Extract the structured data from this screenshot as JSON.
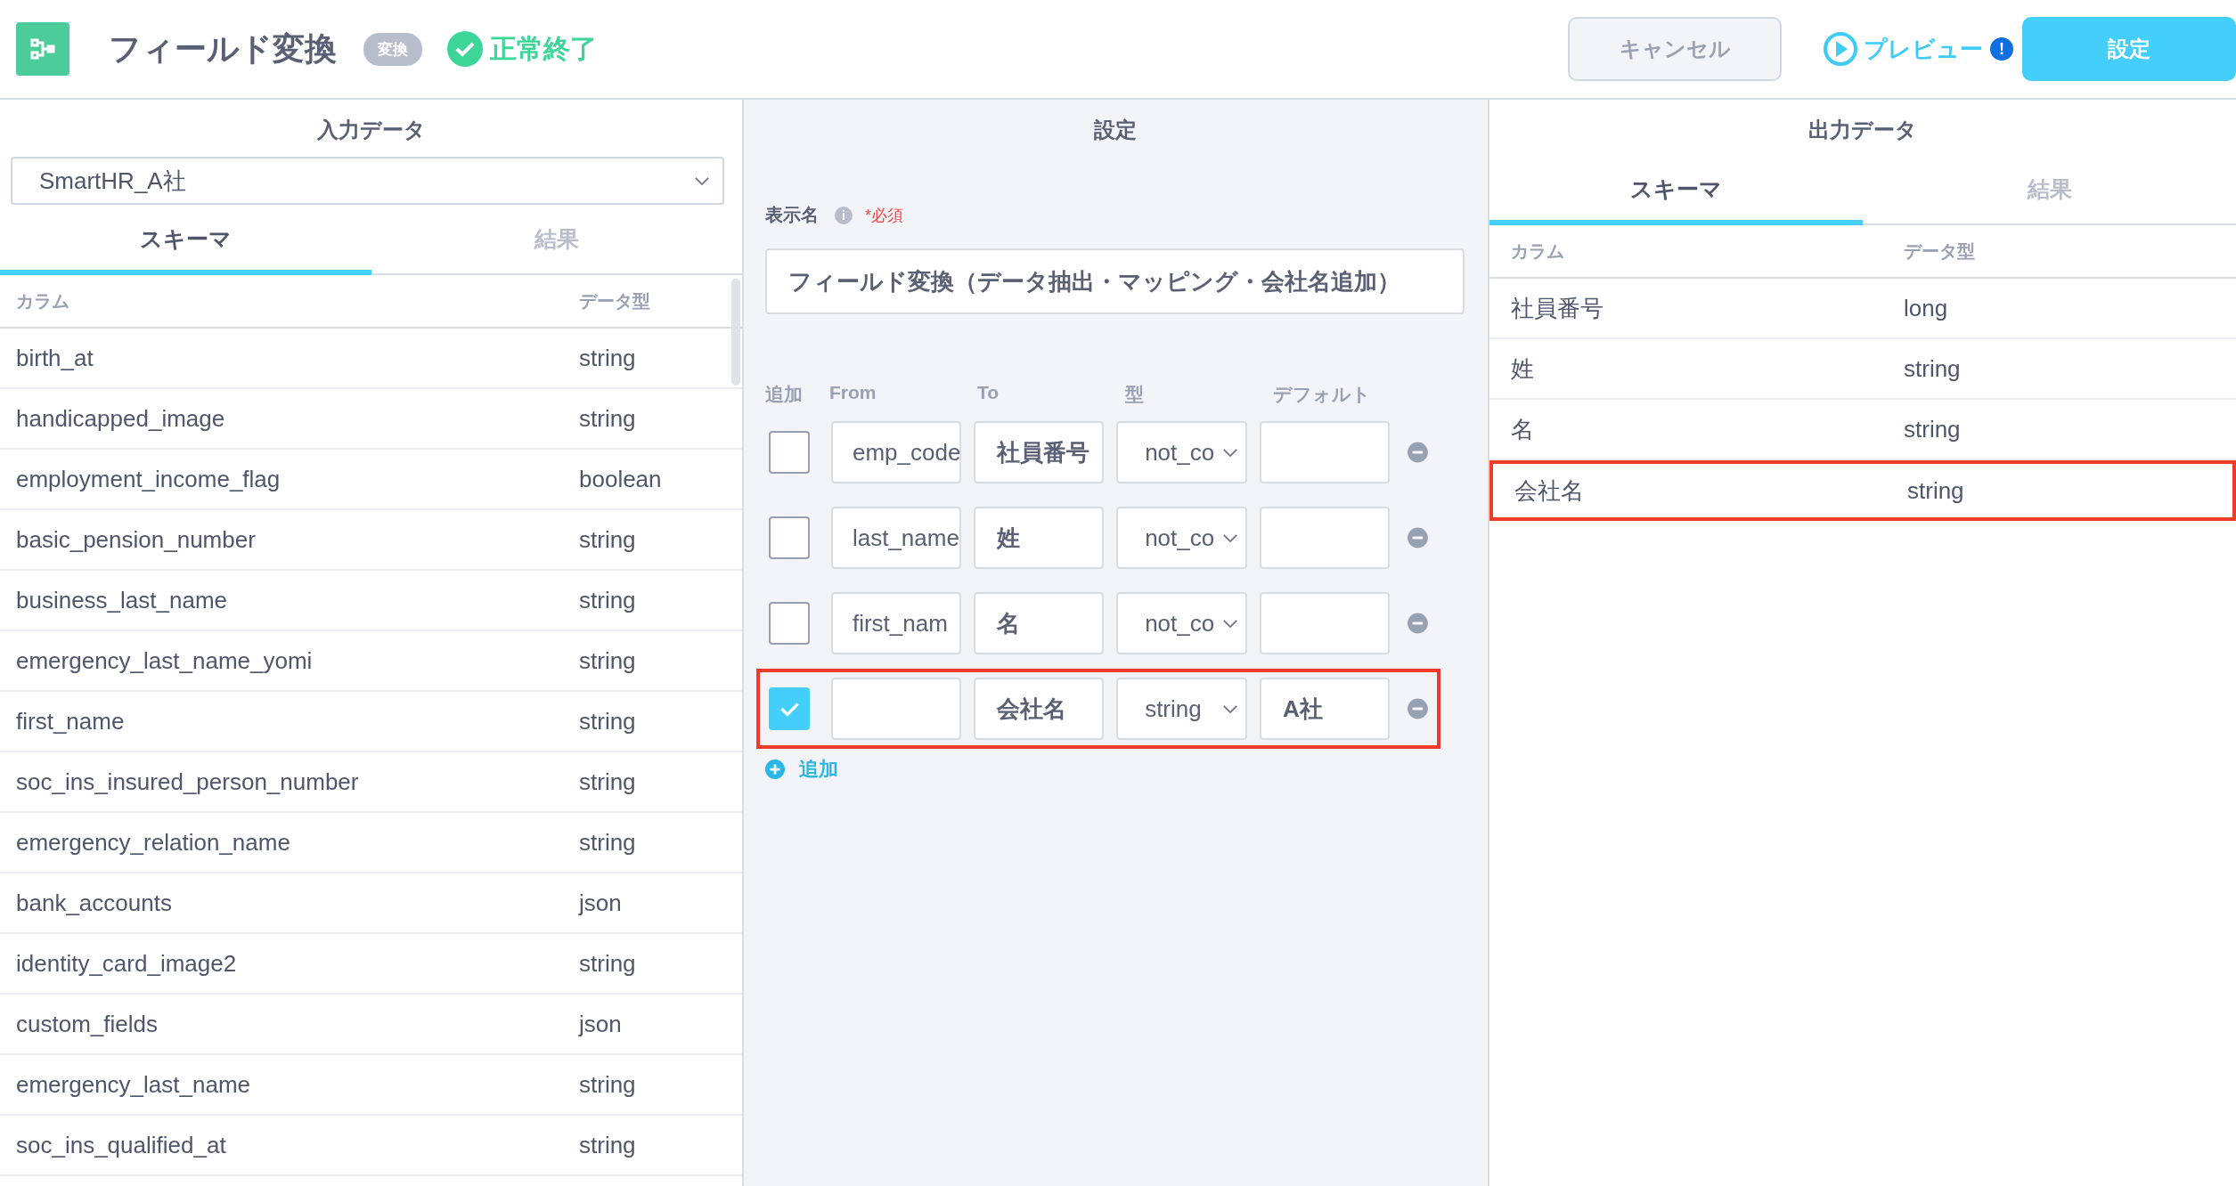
{
  "header": {
    "title": "フィールド変換",
    "badge": "変換",
    "status": "正常終了",
    "buttons": [
      {
        "label": "キャンセル",
        "kind": "secondary"
      },
      {
        "label": "プレビュー",
        "kind": "preview",
        "warning": "!"
      },
      {
        "label": "設定",
        "kind": "primary"
      }
    ]
  },
  "input_panel": {
    "title": "入力データ",
    "source": "SmartHR_A社",
    "tabs": [
      {
        "label": "スキーマ",
        "selected": true
      },
      {
        "label": "結果",
        "selected": false
      }
    ],
    "columns": [
      "カラム",
      "データ型"
    ],
    "rows": [
      [
        "birth_at",
        "string"
      ],
      [
        "handicapped_image",
        "string"
      ],
      [
        "employment_income_flag",
        "boolean"
      ],
      [
        "basic_pension_number",
        "string"
      ],
      [
        "business_last_name",
        "string"
      ],
      [
        "emergency_last_name_yomi",
        "string"
      ],
      [
        "first_name",
        "string"
      ],
      [
        "soc_ins_insured_person_number",
        "string"
      ],
      [
        "emergency_relation_name",
        "string"
      ],
      [
        "bank_accounts",
        "json"
      ],
      [
        "identity_card_image2",
        "string"
      ],
      [
        "custom_fields",
        "json"
      ],
      [
        "emergency_last_name",
        "string"
      ],
      [
        "soc_ins_qualified_at",
        "string"
      ]
    ]
  },
  "settings_panel": {
    "title": "設定",
    "name_label": "表示名",
    "info": "i",
    "required": "*必須",
    "name_value": "フィールド変換（データ抽出・マッピング・会社名追加）",
    "mapping_headers": [
      "追加",
      "From",
      "To",
      "型",
      "デフォルト"
    ],
    "mappings": [
      {
        "checked": false,
        "from": "emp_code",
        "to": "社員番号",
        "type": "not_co",
        "highlighted": false
      },
      {
        "checked": false,
        "from": "last_name",
        "to": "姓",
        "type": "not_co",
        "highlighted": false
      },
      {
        "checked": false,
        "from": "first_nam",
        "to": "名",
        "type": "not_co",
        "highlighted": false
      },
      {
        "checked": true,
        "to": "会社名",
        "type": "string",
        "default": "A社",
        "highlighted": true
      }
    ],
    "add_label": "追加"
  },
  "output_panel": {
    "title": "出力データ",
    "tabs": [
      {
        "label": "スキーマ",
        "selected": true
      },
      {
        "label": "結果",
        "selected": false
      }
    ],
    "columns": [
      "カラム",
      "データ型"
    ],
    "rows": [
      {
        "column": "社員番号",
        "type": "long",
        "highlighted": false
      },
      {
        "column": "姓",
        "type": "string",
        "highlighted": false
      },
      {
        "column": "名",
        "type": "string",
        "highlighted": false
      },
      {
        "column": "会社名",
        "type": "string",
        "highlighted": true
      }
    ]
  }
}
